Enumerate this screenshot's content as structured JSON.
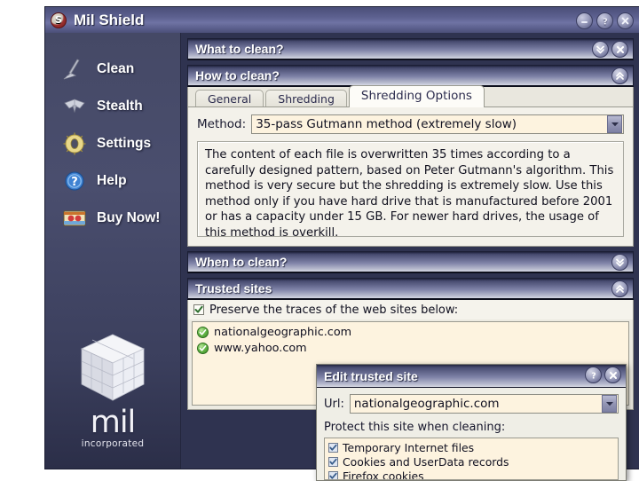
{
  "window": {
    "title": "Mil Shield",
    "app_icon": "S",
    "buttons": [
      {
        "name": "minimize-button",
        "glyph": "minimize"
      },
      {
        "name": "help-button",
        "glyph": "question"
      },
      {
        "name": "close-button",
        "glyph": "close"
      }
    ]
  },
  "sidebar": {
    "items": [
      {
        "label": "Clean",
        "icon": "broom-icon"
      },
      {
        "label": "Stealth",
        "icon": "stealth-plane-icon"
      },
      {
        "label": "Settings",
        "icon": "gear-icon"
      },
      {
        "label": "Help",
        "icon": "question-circle-icon"
      },
      {
        "label": "Buy Now!",
        "icon": "banknote-icon"
      }
    ],
    "brand": {
      "name": "mil",
      "subtitle": "incorporated",
      "logo": "cube-logo"
    }
  },
  "panels": {
    "what_to_clean": {
      "title": "What to clean?",
      "controls": [
        "chevron-double-down-icon",
        "close-icon"
      ],
      "expanded": false
    },
    "how_to_clean": {
      "title": "How to clean?",
      "controls": [
        "chevron-double-up-icon"
      ],
      "expanded": true,
      "tabs": [
        {
          "label": "General",
          "active": false
        },
        {
          "label": "Shredding",
          "active": false
        },
        {
          "label": "Shredding Options",
          "active": true
        }
      ],
      "method": {
        "label": "Method:",
        "value": "35-pass Gutmann method (extremely slow)",
        "arrow": "chevron-down-icon"
      },
      "description": "The content of each file is overwritten 35 times according to a carefully designed pattern, based on Peter Gutmann's algorithm. This method is very secure but the shredding is extremely slow. Use this method only if you have hard drive that is manufactured before 2001 or has a capacity under 15 GB. For newer hard drives, the usage of this method is overkill."
    },
    "when_to_clean": {
      "title": "When to clean?",
      "controls": [
        "chevron-double-down-icon"
      ],
      "expanded": false
    },
    "trusted_sites": {
      "title": "Trusted sites",
      "controls": [
        "chevron-double-up-icon"
      ],
      "expanded": true,
      "preserve": {
        "label": "Preserve the traces of the web sites below:",
        "checked": true
      },
      "sites": [
        {
          "label": "nationalgeographic.com",
          "icon": "green-check-icon"
        },
        {
          "label": "www.yahoo.com",
          "icon": "green-check-icon"
        }
      ]
    }
  },
  "dialog": {
    "title": "Edit trusted site",
    "buttons": [
      {
        "name": "dialog-help-button",
        "glyph": "question"
      },
      {
        "name": "dialog-close-button",
        "glyph": "close"
      }
    ],
    "url": {
      "label": "Url:",
      "value": "nationalgeographic.com",
      "placeholder": "",
      "arrow": "chevron-down-icon"
    },
    "protect_label": "Protect this site when cleaning:",
    "protect_items": [
      {
        "label": "Temporary Internet files",
        "checked": true
      },
      {
        "label": "Cookies and UserData records",
        "checked": true
      },
      {
        "label": "Firefox cookies",
        "checked": true
      }
    ]
  },
  "colors": {
    "titlebar": "#5d6190",
    "sidebar": "#454966",
    "content_bg": "#2f3350",
    "field_bg": "#fdf3df",
    "panel_bg": "#f3f1ea"
  }
}
